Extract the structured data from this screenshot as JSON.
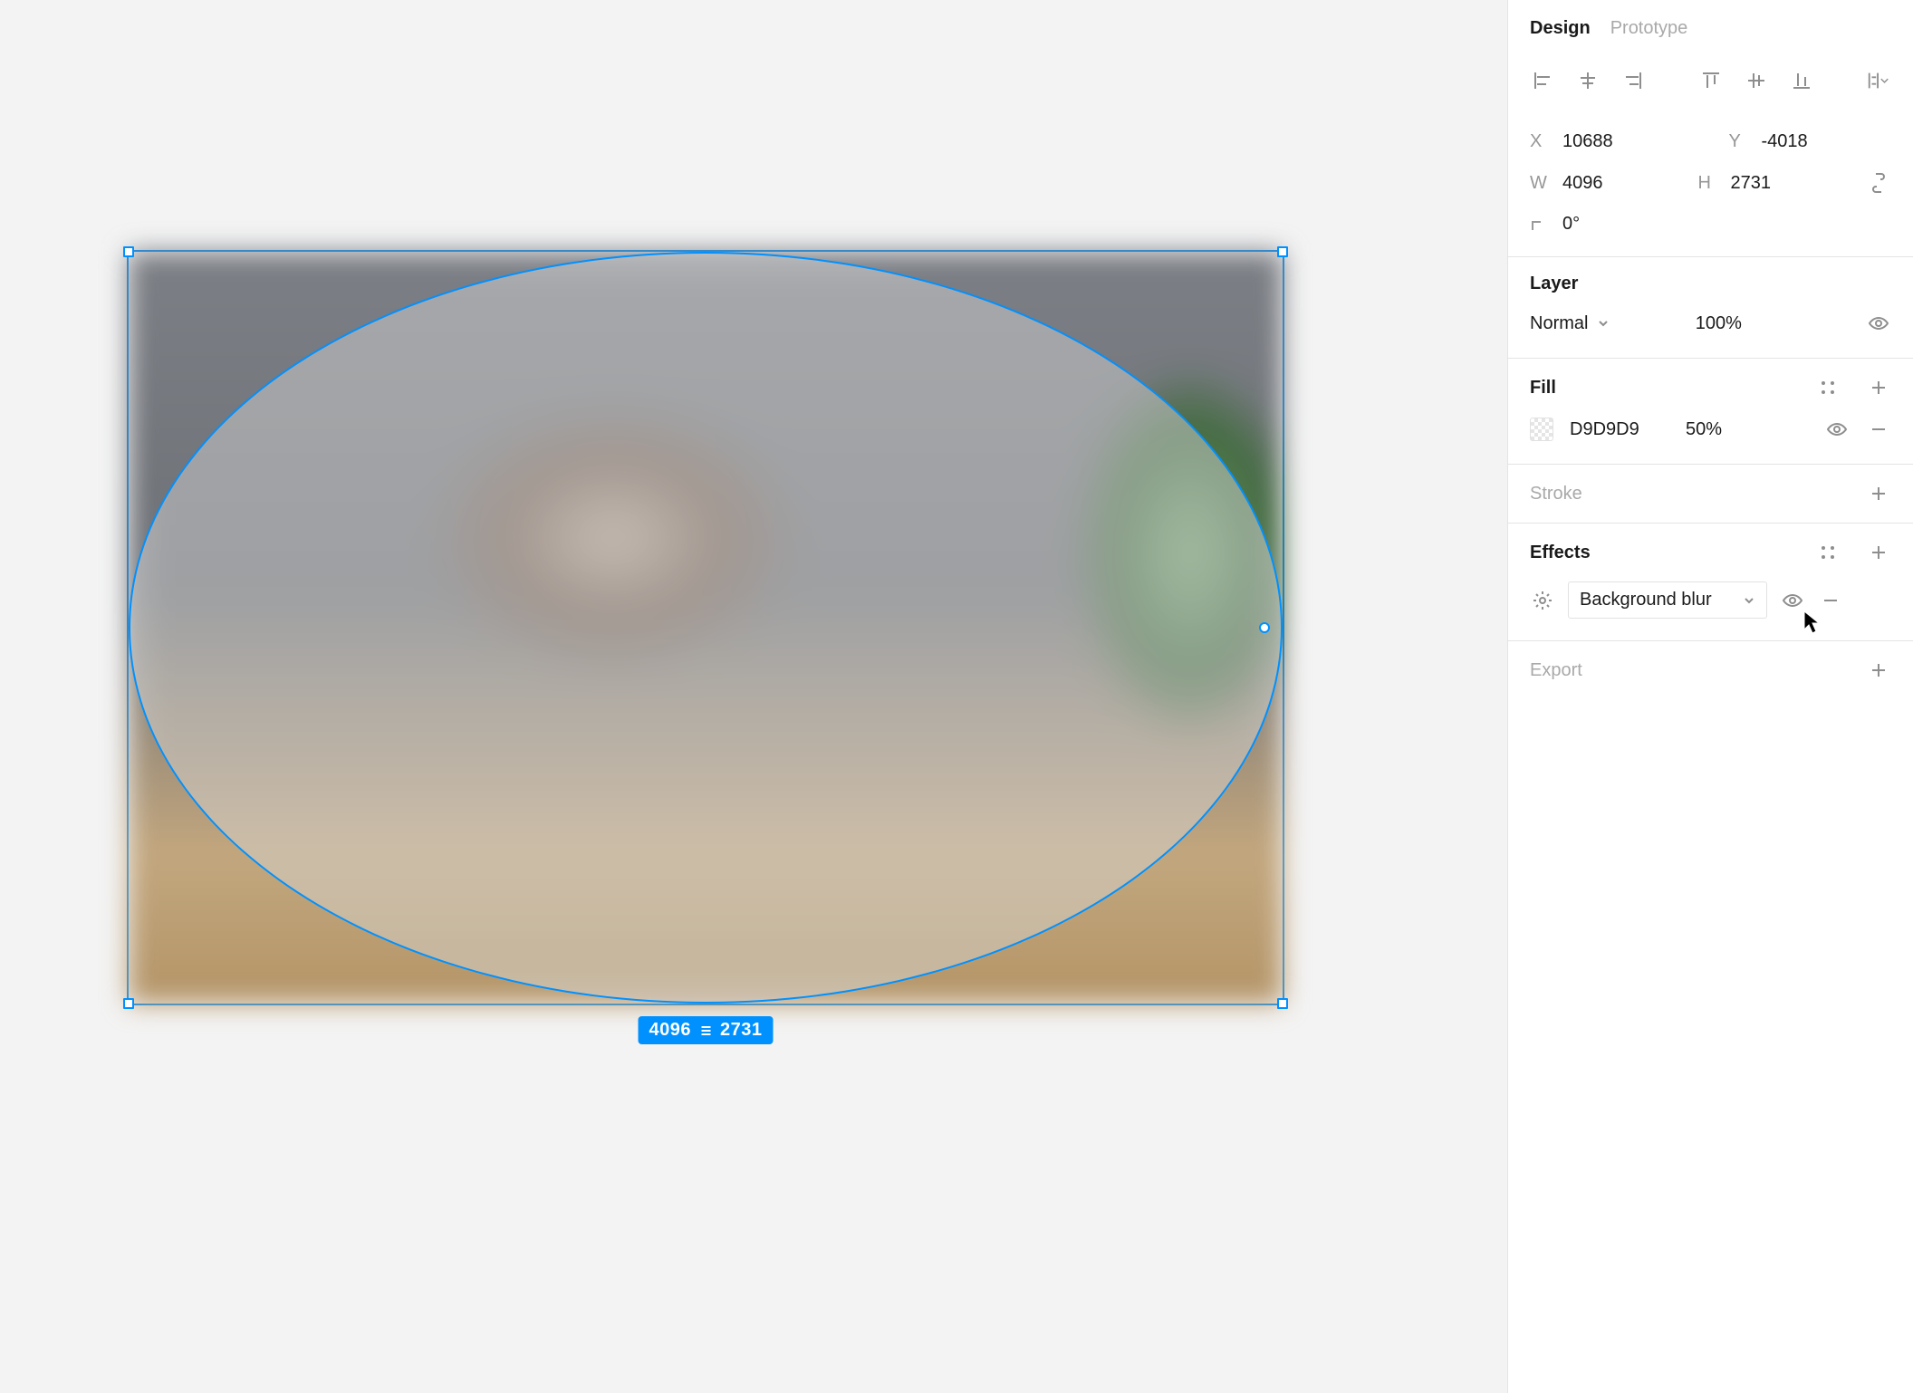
{
  "tabs": {
    "design": "Design",
    "prototype": "Prototype",
    "active": "design"
  },
  "position": {
    "x_label": "X",
    "x": "10688",
    "y_label": "Y",
    "y": "-4018"
  },
  "size": {
    "w_label": "W",
    "w": "4096",
    "h_label": "H",
    "h": "2731"
  },
  "rotation": {
    "label": "",
    "value": "0°"
  },
  "layer": {
    "title": "Layer",
    "blend_mode": "Normal",
    "opacity": "100%"
  },
  "fill": {
    "title": "Fill",
    "hex": "D9D9D9",
    "opacity": "50%"
  },
  "stroke": {
    "title": "Stroke"
  },
  "effects": {
    "title": "Effects",
    "selected": "Background blur"
  },
  "export": {
    "title": "Export"
  },
  "selection": {
    "dim_w": "4096",
    "dim_h": "2731"
  }
}
